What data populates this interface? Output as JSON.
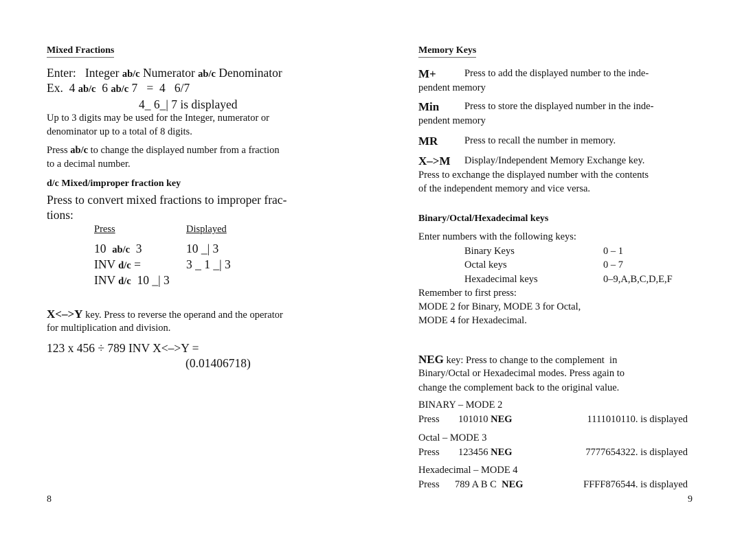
{
  "left_page": {
    "mixed_fractions": {
      "heading": "Mixed Fractions",
      "enter_line": {
        "prefix": "Enter:   Integer ",
        "k1": "ab/c",
        "mid": " Numerator ",
        "k2": "ab/c",
        "suffix": " Denominator"
      },
      "example_line": {
        "prefix": "Ex.  4 ",
        "k1": "ab/c",
        "mid": "  6 ",
        "k2": "ab/c",
        "suffix": " 7   =  4   6/7"
      },
      "displayed_line": "4_ 6_| 7 is displayed",
      "note1_l1": "Up to 3 digits may be used for the Integer, numerator or",
      "note1_l2": "denominator up to a total of 8 digits.",
      "note2_l1": {
        "prefix": "Press ",
        "key": "ab/c",
        "suffix": " to change the displayed number from a fraction"
      },
      "note2_l2": "to a decimal number."
    },
    "dc_key": {
      "heading": "d/c Mixed/improper fraction key",
      "desc_l1": "Press to convert mixed fractions to improper frac-",
      "desc_l2": "tions:",
      "table": {
        "col_press": "Press",
        "col_displayed": "Displayed",
        "rows": [
          {
            "press_pre": "10  ",
            "press_key": "ab/c",
            "press_post": "  3",
            "displayed": "10 _| 3"
          },
          {
            "press_pre": "INV ",
            "press_key": "d/c",
            "press_post": " =",
            "displayed": "3 _ 1 _| 3"
          },
          {
            "press_pre": "INV ",
            "press_key": "d/c",
            "press_post": "  10 _| 3",
            "displayed": ""
          }
        ]
      }
    },
    "xy_key": {
      "key": "X<–>Y",
      "desc_l1": " key. Press to reverse the operand and the operator",
      "desc_l2": "for multiplication and division.",
      "example": "123 x 456 ÷ 789 INV X<–>Y =",
      "result": "(0.01406718)"
    },
    "page_number": "8"
  },
  "right_page": {
    "memory": {
      "heading": "Memory Keys",
      "items": [
        {
          "key": "M+",
          "desc_l1": "Press to add the displayed number to the inde-",
          "desc_l2": "pendent memory"
        },
        {
          "key": "Min",
          "desc_l1": "Press to store the displayed number in the inde-",
          "desc_l2": "pendent memory"
        },
        {
          "key": "MR",
          "desc_l1": "Press to recall the number in memory.",
          "desc_l2": ""
        },
        {
          "key": "X–>M",
          "desc_l1": "Display/Independent Memory Exchange key.",
          "desc_l2": "Press to exchange the displayed number with the contents",
          "desc_l3": "of the independent memory and vice versa."
        }
      ]
    },
    "bases": {
      "heading": "Binary/Octal/Hexadecimal keys",
      "intro": "Enter numbers with the following keys:",
      "keys": [
        {
          "name": "Binary Keys",
          "range": "0 – 1"
        },
        {
          "name": "Octal keys",
          "range": "0 – 7"
        },
        {
          "name": "Hexadecimal keys",
          "range": "0–9,A,B,C,D,E,F"
        }
      ],
      "remember": "Remember to first press:",
      "mode_l1": "MODE 2 for Binary,  MODE 3 for Octal,",
      "mode_l2": "MODE 4 for Hexadecimal."
    },
    "neg": {
      "key": "NEG",
      "desc_l1": " key: Press to change to the complement  in",
      "desc_l2": "Binary/Octal or Hexadecimal modes. Press again to",
      "desc_l3": "change the complement back to the original value.",
      "examples": [
        {
          "mode": "BINARY – MODE  2",
          "press": "Press",
          "input": "101010 ",
          "key": "NEG",
          "result": "1111010110. is displayed"
        },
        {
          "mode": "Octal – MODE  3",
          "press": "Press",
          "input": "123456 ",
          "key": "NEG",
          "result": "7777654322. is displayed"
        },
        {
          "mode": "Hexadecimal –  MODE  4",
          "press": "Press",
          "input": "789 A B C  ",
          "key": "NEG",
          "result": "FFFF876544. is displayed"
        }
      ]
    },
    "page_number": "9"
  }
}
